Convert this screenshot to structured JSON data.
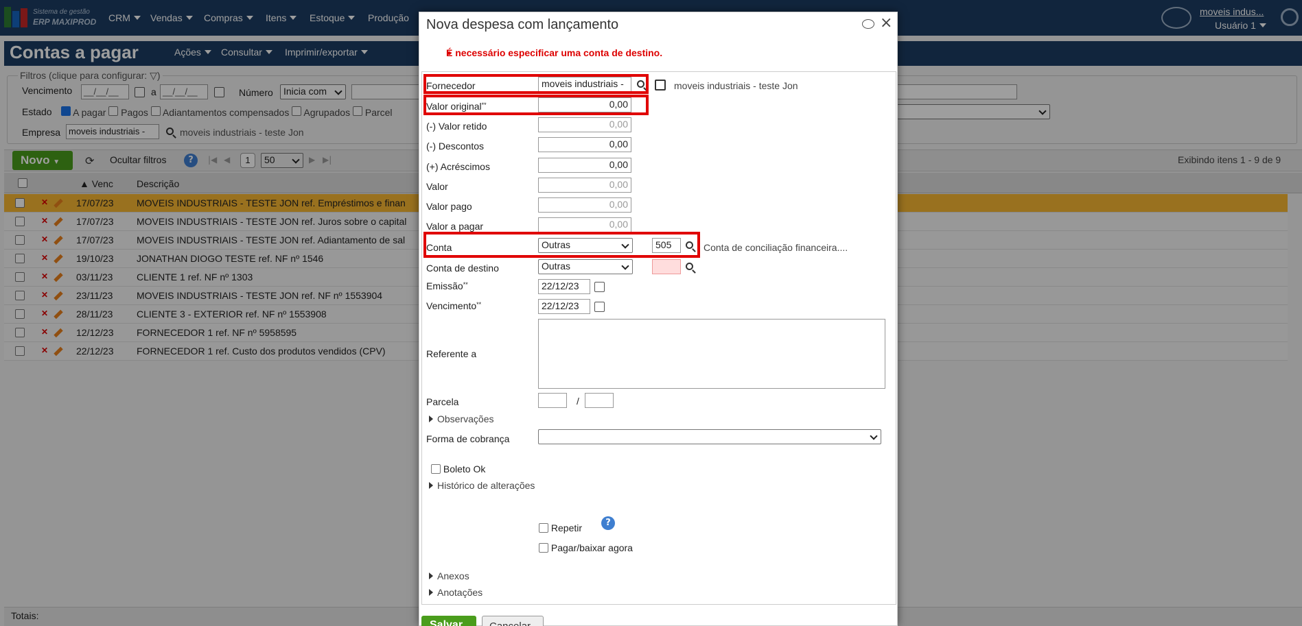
{
  "brand": {
    "line1": "Sistema de gestão",
    "line2": "ERP MAXIPROD"
  },
  "nav": [
    "CRM",
    "Vendas",
    "Compras",
    "Itens",
    "Estoque",
    "Produção"
  ],
  "user": {
    "company_link": "moveis indus...",
    "name": "Usuário 1"
  },
  "page": {
    "title": "Contas a pagar",
    "menus": [
      "Ações",
      "Consultar",
      "Imprimir/exportar"
    ]
  },
  "filters": {
    "legend": "Filtros (clique para configurar:",
    "legend_end": ")",
    "vencimento_label": "Vencimento",
    "date_placeholder": "__/__/__",
    "a_label": "a",
    "numero_label": "Número",
    "numero_select": "Inicia com",
    "estado_label": "Estado",
    "estados": [
      "A pagar",
      "Pagos",
      "Adiantamentos compensados",
      "Agrupados",
      "Parcel"
    ],
    "empresa_label": "Empresa",
    "empresa_value": "moveis industriais -",
    "empresa_text": "moveis industriais - teste Jon"
  },
  "toolbar": {
    "novo": "Novo",
    "ocultar": "Ocultar filtros",
    "page": "1",
    "per_page": "50",
    "exibindo": "Exibindo itens 1 - 9 de 9"
  },
  "grid": {
    "headers": {
      "venc": "Venc",
      "descricao": "Descrição"
    },
    "rows": [
      {
        "date": "17/07/23",
        "desc": "MOVEIS INDUSTRIAIS - TESTE JON ref. Empréstimos e finan"
      },
      {
        "date": "17/07/23",
        "desc": "MOVEIS INDUSTRIAIS - TESTE JON ref. Juros sobre o capital"
      },
      {
        "date": "17/07/23",
        "desc": "MOVEIS INDUSTRIAIS - TESTE JON ref. Adiantamento de sal"
      },
      {
        "date": "19/10/23",
        "desc": "JONATHAN DIOGO TESTE ref. NF nº 1546"
      },
      {
        "date": "03/11/23",
        "desc": "CLIENTE 1 ref. NF nº 1303"
      },
      {
        "date": "23/11/23",
        "desc": "MOVEIS INDUSTRIAIS - TESTE JON ref. NF nº 1553904"
      },
      {
        "date": "28/11/23",
        "desc": "CLIENTE 3 - EXTERIOR ref. NF nº 1553908"
      },
      {
        "date": "12/12/23",
        "desc": "FORNECEDOR 1 ref. NF nº 5958595"
      },
      {
        "date": "22/12/23",
        "desc": "FORNECEDOR 1 ref. Custo dos produtos vendidos (CPV)"
      }
    ],
    "totais": "Totais:"
  },
  "modal": {
    "title": "Nova despesa com lançamento",
    "error": "É necessário especificar uma conta de destino.",
    "fornecedor_label": "Fornecedor",
    "fornecedor_value": "moveis industriais -",
    "fornecedor_text": "moveis industriais - teste Jon",
    "valor_original_label": "Valor original",
    "valor_original": "0,00",
    "valor_retido_label": "(-) Valor retido",
    "valor_retido": "0,00",
    "descontos_label": "(-) Descontos",
    "descontos": "0,00",
    "acrescimos_label": "(+) Acréscimos",
    "acrescimos": "0,00",
    "valor_label": "Valor",
    "valor": "0,00",
    "valor_pago_label": "Valor pago",
    "valor_pago": "0,00",
    "valor_a_pagar_label": "Valor a pagar",
    "valor_a_pagar": "0,00",
    "conta_label": "Conta",
    "conta_tipo": "Outras",
    "conta_num": "505",
    "conta_text": "Conta de conciliação financeira....",
    "conta_destino_label": "Conta de destino",
    "conta_destino_tipo": "Outras",
    "emissao_label": "Emissão",
    "emissao": "22/12/23",
    "vencimento_label": "Vencimento",
    "vencimento": "22/12/23",
    "referente_label": "Referente a",
    "parcela_label": "Parcela",
    "parcela_sep": "/",
    "observacoes": "Observações",
    "forma_label": "Forma de cobrança",
    "boleto_ok": "Boleto Ok",
    "historico": "Histórico de alterações",
    "repetir": "Repetir",
    "pagar_agora": "Pagar/baixar agora",
    "anexos": "Anexos",
    "anotacoes": "Anotações",
    "salvar": "Salvar",
    "cancelar": "Cancelar"
  },
  "colors": {
    "nav_bg": "#1c3d63",
    "selected_row": "#f7b733",
    "highlight": "#e00000",
    "save_green": "#4a9d1c"
  }
}
